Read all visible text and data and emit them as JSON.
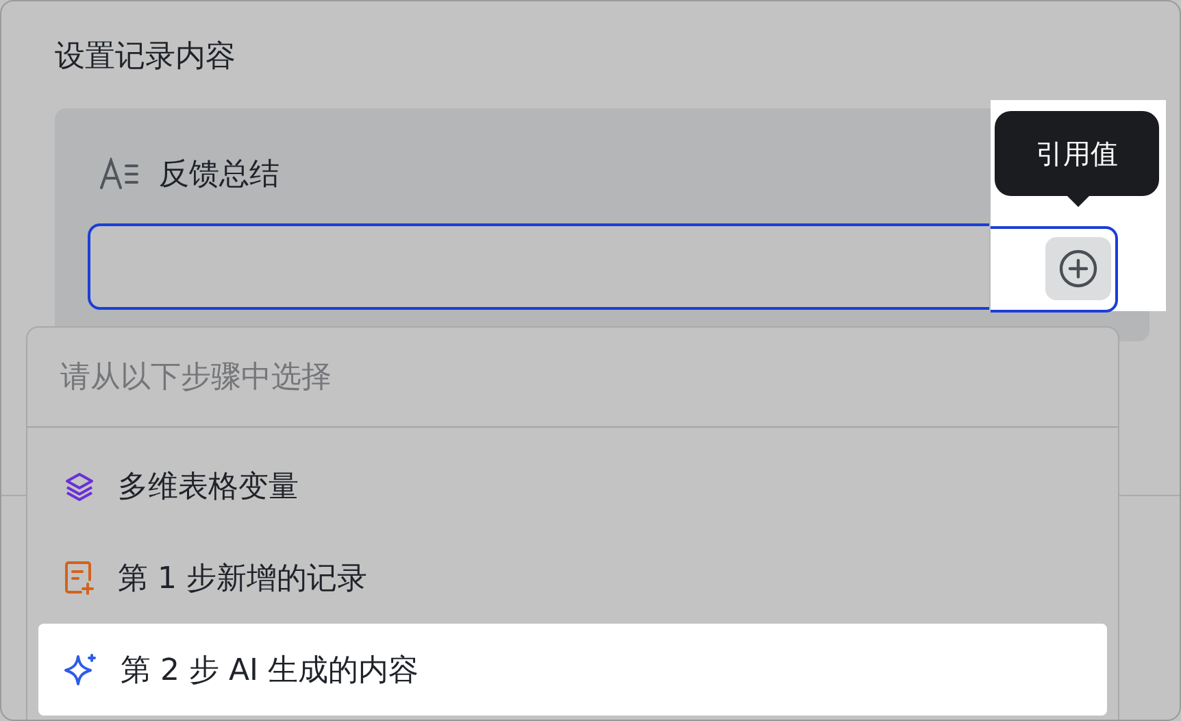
{
  "section_title": "设置记录内容",
  "field": {
    "label": "反馈总结",
    "focused": true
  },
  "tooltip": {
    "text": "引用值"
  },
  "menu": {
    "header": "请从以下步骤中选择",
    "items": [
      {
        "kind": "variable",
        "label": "多维表格变量",
        "selected": false
      },
      {
        "kind": "record",
        "label": "第 1 步新增的记录",
        "selected": false
      },
      {
        "kind": "ai",
        "label": "第 2 步 AI 生成的内容",
        "selected": true
      }
    ]
  }
}
